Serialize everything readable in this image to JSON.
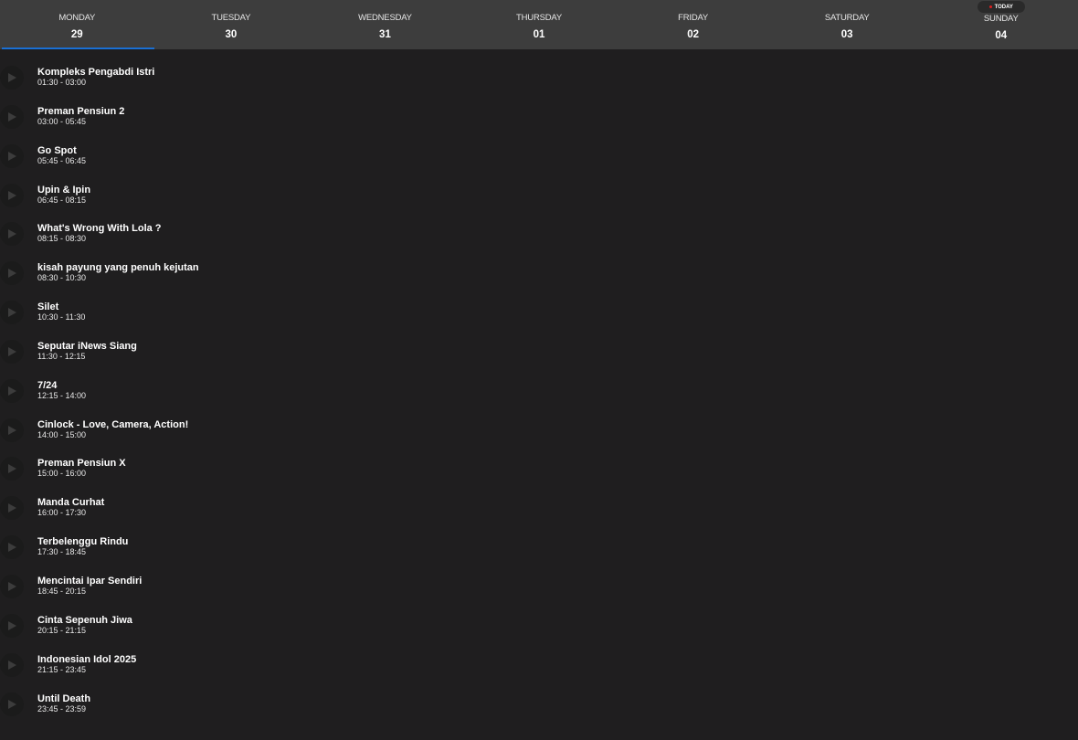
{
  "days": [
    {
      "name": "MONDAY",
      "num": "29"
    },
    {
      "name": "TUESDAY",
      "num": "30"
    },
    {
      "name": "WEDNESDAY",
      "num": "31"
    },
    {
      "name": "THURSDAY",
      "num": "01"
    },
    {
      "name": "FRIDAY",
      "num": "02"
    },
    {
      "name": "SATURDAY",
      "num": "03"
    },
    {
      "name": "SUNDAY",
      "num": "04"
    }
  ],
  "today_badge": "TODAY",
  "active_day_index": 0,
  "colors": {
    "active_underline": "#1a6fd4",
    "today_dot": "#e01e1e"
  },
  "icons": {
    "play": "play-icon"
  },
  "programs": [
    {
      "title": "Kompleks Pengabdi Istri",
      "time": "01:30 - 03:00"
    },
    {
      "title": "Preman Pensiun 2",
      "time": "03:00 - 05:45"
    },
    {
      "title": "Go Spot",
      "time": "05:45 - 06:45"
    },
    {
      "title": "Upin & Ipin",
      "time": "06:45 - 08:15"
    },
    {
      "title": "What's Wrong With Lola ?",
      "time": "08:15 - 08:30"
    },
    {
      "title": "kisah payung yang penuh kejutan",
      "time": "08:30 - 10:30"
    },
    {
      "title": "Silet",
      "time": "10:30 - 11:30"
    },
    {
      "title": "Seputar iNews Siang",
      "time": "11:30 - 12:15"
    },
    {
      "title": "7/24",
      "time": "12:15 - 14:00"
    },
    {
      "title": "Cinlock - Love, Camera, Action!",
      "time": "14:00 - 15:00"
    },
    {
      "title": "Preman Pensiun X",
      "time": "15:00 - 16:00"
    },
    {
      "title": "Manda Curhat",
      "time": "16:00 - 17:30"
    },
    {
      "title": "Terbelenggu Rindu",
      "time": "17:30 - 18:45"
    },
    {
      "title": "Mencintai Ipar Sendiri",
      "time": "18:45 - 20:15"
    },
    {
      "title": "Cinta Sepenuh Jiwa",
      "time": "20:15 - 21:15"
    },
    {
      "title": "Indonesian Idol 2025",
      "time": "21:15 - 23:45"
    },
    {
      "title": "Until Death",
      "time": "23:45 - 23:59"
    }
  ]
}
